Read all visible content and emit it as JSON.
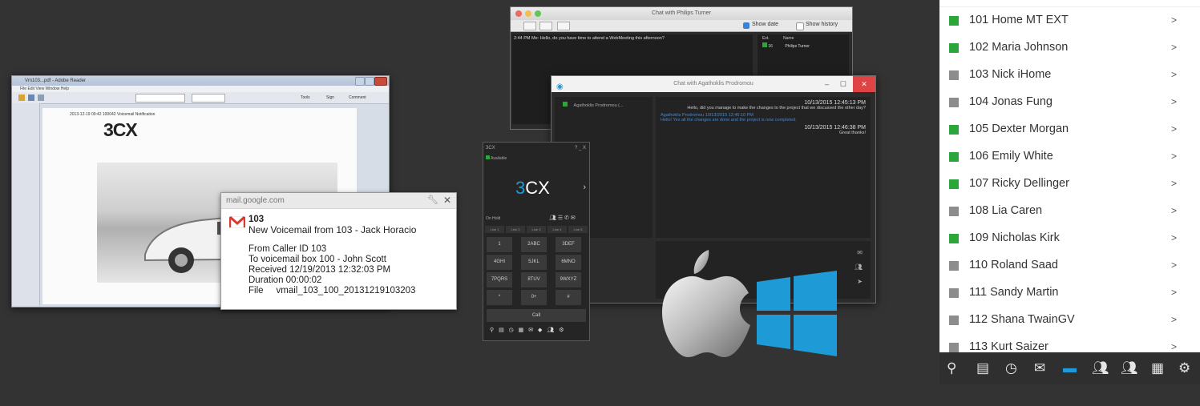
{
  "pdf": {
    "title": "Vm103...pdf - Adobe Reader",
    "menu": "File  Edit  View  Window  Help",
    "tools_label": "Tools",
    "sign_label": "Sign",
    "comment_label": "Comment",
    "page_logo": "3CX",
    "page_header": "2013-12-19 09:42  100042  Voicemail Notification"
  },
  "notification": {
    "source": "mail.google.com",
    "sender": "103",
    "subject": "New Voicemail from 103 - Jack Horacio",
    "lines": [
      "From Caller ID 103",
      "To voicemail box 100 - John Scott",
      "Received 12/19/2013 12:32:03 PM",
      "Duration 00:00:02",
      "File     vmail_103_100_20131219103203"
    ]
  },
  "mac_chat": {
    "title": "Chat with Philips Turner",
    "show_date": "Show date",
    "show_history": "Show history",
    "message": "2:44 PM Me: Hello, do you have time to attend a WebMeeting this afternoon?",
    "col_ext": "Ext.",
    "col_name": "Name",
    "participant_ext": "16",
    "participant_name": "Philips Turner"
  },
  "win_chat": {
    "title": "Chat with Agathoklis Prodromou",
    "participant": "Agathoklis Prodromou (...",
    "messages": [
      {
        "time": "10/13/2015 12:45:13 PM",
        "text": "Hello, did you manage to make the changes to the project that we discussed the other day?",
        "color": "#d8d8d8"
      },
      {
        "time": "Agathoklis Prodromou 10/13/2015 12:46:10 PM",
        "text": "Hello! Yes all the changes are done and the project is now completed.",
        "color": "#4a86c8"
      },
      {
        "time": "10/13/2015 12:46:38 PM",
        "text": "Great thanks!",
        "color": "#d8d8d8"
      }
    ]
  },
  "phone": {
    "title": "3CX",
    "window_controls": "? _ X",
    "status": "Available",
    "logo_prefix": "3",
    "logo_suffix": "CX",
    "on_hold": "On Hold",
    "lines": [
      "Line 1",
      "Line 2",
      "Line 3",
      "Line 4",
      "Line 5"
    ],
    "keys": [
      "1",
      "2ABC",
      "3DEF",
      "4GHI",
      "5JKL",
      "6MNO",
      "7PQRS",
      "8TUV",
      "9WXYZ",
      "*",
      "0+",
      "#"
    ],
    "call": "Call"
  },
  "contacts": [
    {
      "name": "101 Home MT EXT",
      "status": "green"
    },
    {
      "name": "102 Maria Johnson",
      "status": "green"
    },
    {
      "name": "103 Nick iHome",
      "status": "gray"
    },
    {
      "name": "104 Jonas Fung",
      "status": "gray"
    },
    {
      "name": "105 Dexter Morgan",
      "status": "green"
    },
    {
      "name": "106 Emily White",
      "status": "green"
    },
    {
      "name": "107 Ricky Dellinger",
      "status": "green"
    },
    {
      "name": "108 Lia Caren",
      "status": "gray"
    },
    {
      "name": "109 Nicholas Kirk",
      "status": "green"
    },
    {
      "name": "110 Roland Saad",
      "status": "gray"
    },
    {
      "name": "111 Sandy Martin",
      "status": "gray"
    },
    {
      "name": "112 Shana TwainGV",
      "status": "gray"
    },
    {
      "name": "113 Kurt Saizer",
      "status": "gray"
    }
  ],
  "contact_arrow": ">",
  "colors": {
    "green": "#2aa63a",
    "gray": "#8c8c8c",
    "accent_blue": "#1e9bd7",
    "background": "#333333"
  },
  "bottom_bar_icons": [
    "presence-icon",
    "phonebook-icon",
    "history-icon",
    "voicemail-icon",
    "chat-icon",
    "conference-icon",
    "group-icon",
    "switchboard-icon",
    "settings-icon"
  ]
}
